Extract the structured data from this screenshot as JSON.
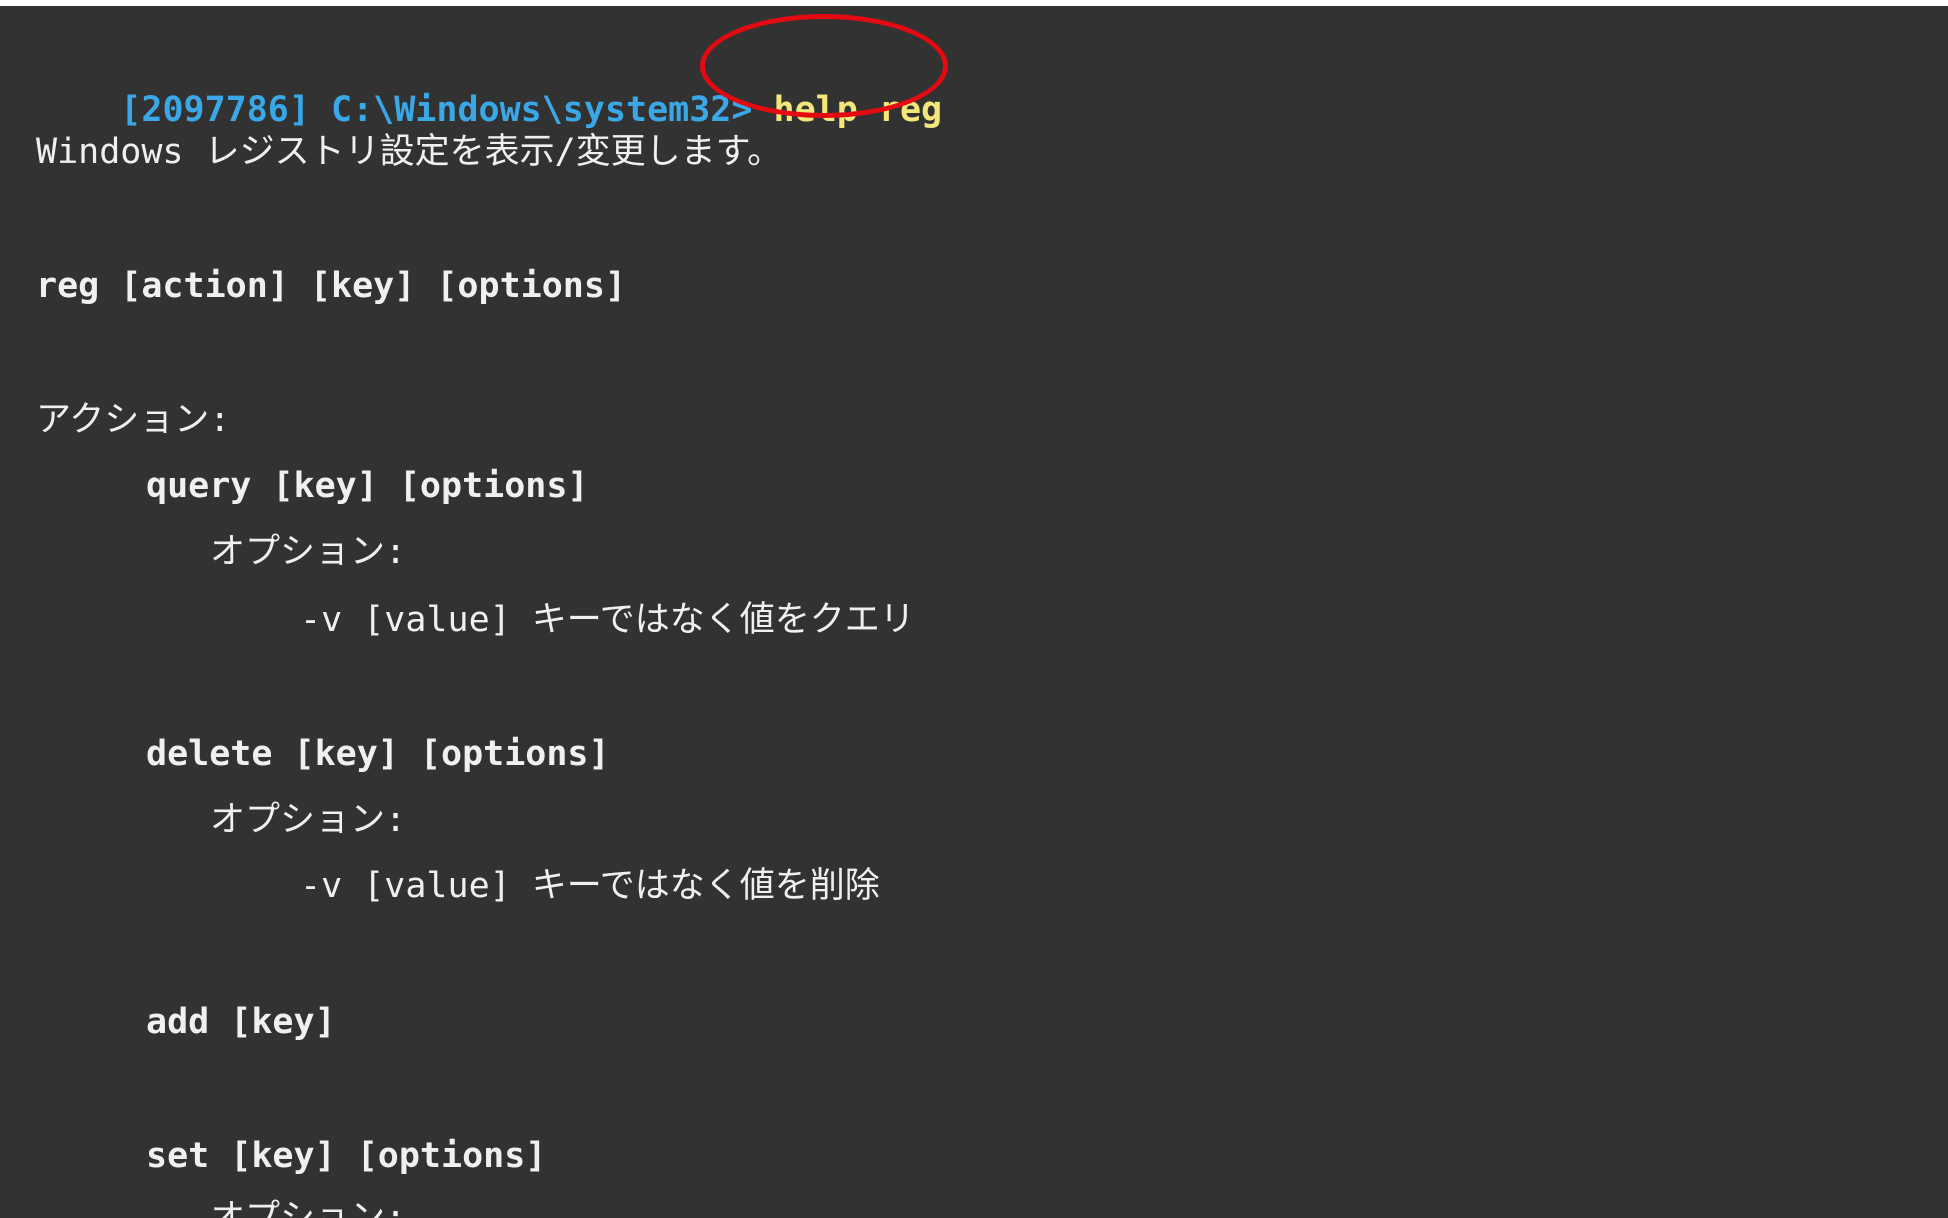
{
  "terminal": {
    "prompt": "[2097786] C:\\Windows\\system32>",
    "command": "help reg",
    "description": "Windows レジストリ設定を表示/変更します。",
    "usage": "reg [action] [key] [options]",
    "actions_header": "アクション:",
    "actions": [
      {
        "syntax": "query [key] [options]",
        "options_header": "オプション:",
        "option": "-v [value] キーではなく値をクエリ"
      },
      {
        "syntax": "delete [key] [options]",
        "options_header": "オプション:",
        "option": "-v [value] キーではなく値を削除"
      },
      {
        "syntax": "add [key]"
      },
      {
        "syntax": "set [key] [options]",
        "options_header": "オプション:"
      }
    ]
  },
  "annotation": {
    "color": "#e40a12"
  }
}
